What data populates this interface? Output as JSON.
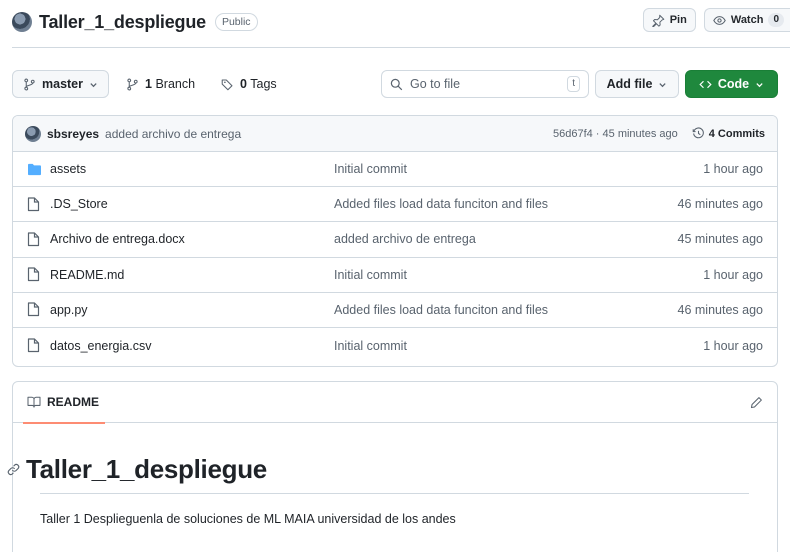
{
  "repo": {
    "name": "Taller_1_despliegue",
    "visibility": "Public"
  },
  "header_actions": {
    "pin_label": "Pin",
    "watch_label": "Watch",
    "watch_count": "0"
  },
  "toolbar": {
    "branch": "master",
    "branch_count": "1",
    "branch_word": "Branch",
    "tag_count": "0",
    "tag_word": "Tags",
    "goto_placeholder": "Go to file",
    "goto_shortcut": "t",
    "add_file_label": "Add file",
    "code_label": "Code"
  },
  "latest_commit": {
    "author": "sbsreyes",
    "message": "added archivo de entrega",
    "hash_time": "56d67f4 · 45 minutes ago",
    "commits_label": "4 Commits"
  },
  "files": [
    {
      "name": "assets",
      "type": "folder",
      "commit": "Initial commit",
      "time": "1 hour ago"
    },
    {
      "name": ".DS_Store",
      "type": "file",
      "commit": "Added files load data funciton and files",
      "time": "46 minutes ago"
    },
    {
      "name": "Archivo de entrega.docx",
      "type": "file",
      "commit": "added archivo de entrega",
      "time": "45 minutes ago"
    },
    {
      "name": "README.md",
      "type": "file",
      "commit": "Initial commit",
      "time": "1 hour ago"
    },
    {
      "name": "app.py",
      "type": "file",
      "commit": "Added files load data funciton and files",
      "time": "46 minutes ago"
    },
    {
      "name": "datos_energia.csv",
      "type": "file",
      "commit": "Initial commit",
      "time": "1 hour ago"
    }
  ],
  "readme": {
    "tab_label": "README",
    "title": "Taller_1_despliegue",
    "body": "Taller 1 Desplieguenla de soluciones de ML MAIA universidad de los andes"
  },
  "colors": {
    "primary_button": "#1f883d",
    "folder_icon": "#54aeff",
    "tab_underline": "#fd8c73",
    "border": "#d1d9e0"
  }
}
